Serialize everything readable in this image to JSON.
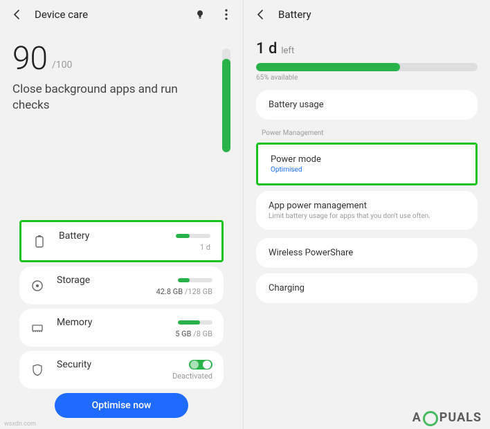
{
  "left": {
    "header": {
      "title": "Device care"
    },
    "score": {
      "value": "90",
      "denominator": "/100",
      "message": "Close background apps and run checks",
      "bar_pct": 90
    },
    "resources": {
      "battery": {
        "label": "Battery",
        "sub": "1 d",
        "bar_pct": 40
      },
      "storage": {
        "label": "Storage",
        "used": "42.8 GB",
        "total": "128 GB",
        "bar_pct": 34
      },
      "memory": {
        "label": "Memory",
        "used": "5 GB",
        "total": "8 GB",
        "bar_pct": 63
      },
      "security": {
        "label": "Security",
        "status": "Deactivated"
      }
    },
    "optimise_label": "Optimise now"
  },
  "right": {
    "header": {
      "title": "Battery"
    },
    "time_left": {
      "value": "1 d",
      "suffix": "left"
    },
    "bar_pct": 65,
    "available_label": "65% available",
    "cards": {
      "usage": "Battery usage",
      "pm_section": "Power Management",
      "power_mode": {
        "title": "Power mode",
        "sub": "Optimised"
      },
      "app_power": {
        "title": "App power management",
        "sub": "Limit battery usage for apps that you don't use often."
      },
      "wireless": "Wireless PowerShare",
      "charging": "Charging"
    }
  },
  "watermark": {
    "brand_prefix": "A",
    "brand_suffix": "PUALS",
    "site": "wsxdn.com"
  },
  "colors": {
    "accent": "#2ab24a",
    "highlight": "#19c21f",
    "primary_btn": "#1f6bff"
  }
}
